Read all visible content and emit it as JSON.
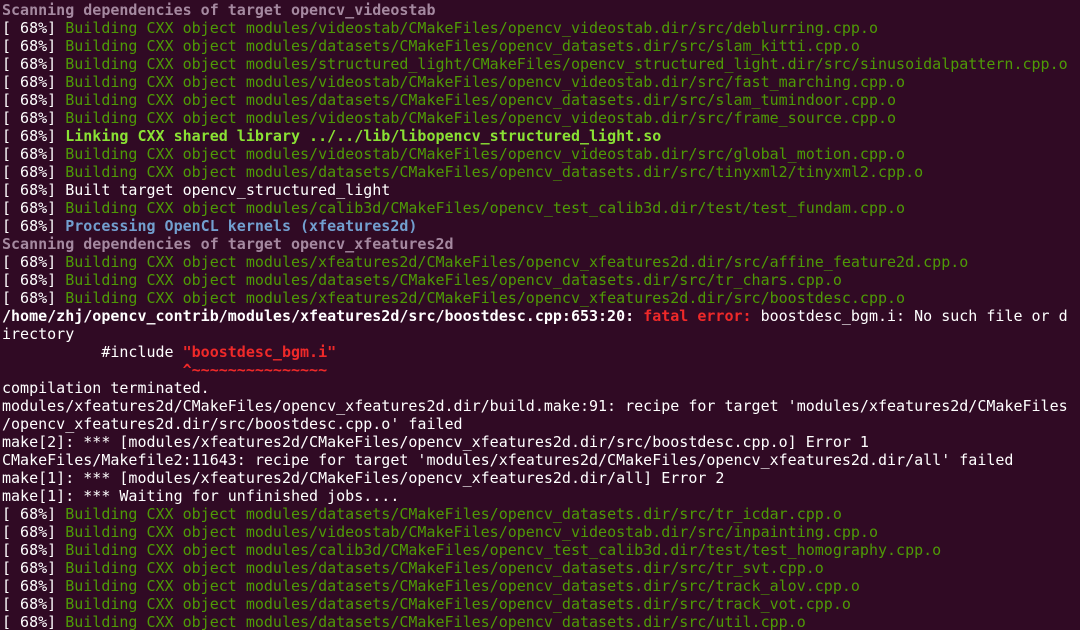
{
  "lines": [
    {
      "type": "scan",
      "text": "Scanning dependencies of target opencv_videostab"
    },
    {
      "type": "build",
      "prefix": "[ 68%] ",
      "text": "Building CXX object modules/videostab/CMakeFiles/opencv_videostab.dir/src/deblurring.cpp.o"
    },
    {
      "type": "build",
      "prefix": "[ 68%] ",
      "text": "Building CXX object modules/datasets/CMakeFiles/opencv_datasets.dir/src/slam_kitti.cpp.o"
    },
    {
      "type": "build",
      "prefix": "[ 68%] ",
      "text": "Building CXX object modules/structured_light/CMakeFiles/opencv_structured_light.dir/src/sinusoidalpattern.cpp.o"
    },
    {
      "type": "build",
      "prefix": "[ 68%] ",
      "text": "Building CXX object modules/videostab/CMakeFiles/opencv_videostab.dir/src/fast_marching.cpp.o"
    },
    {
      "type": "build",
      "prefix": "[ 68%] ",
      "text": "Building CXX object modules/datasets/CMakeFiles/opencv_datasets.dir/src/slam_tumindoor.cpp.o"
    },
    {
      "type": "build",
      "prefix": "[ 68%] ",
      "text": "Building CXX object modules/videostab/CMakeFiles/opencv_videostab.dir/src/frame_source.cpp.o"
    },
    {
      "type": "link",
      "prefix": "[ 68%] ",
      "text": "Linking CXX shared library ../../lib/libopencv_structured_light.so"
    },
    {
      "type": "build",
      "prefix": "[ 68%] ",
      "text": "Building CXX object modules/videostab/CMakeFiles/opencv_videostab.dir/src/global_motion.cpp.o"
    },
    {
      "type": "build",
      "prefix": "[ 68%] ",
      "text": "Building CXX object modules/datasets/CMakeFiles/opencv_datasets.dir/src/tinyxml2/tinyxml2.cpp.o"
    },
    {
      "type": "plain",
      "prefix": "[ 68%] ",
      "text": "Built target opencv_structured_light"
    },
    {
      "type": "build",
      "prefix": "[ 68%] ",
      "text": "Building CXX object modules/calib3d/CMakeFiles/opencv_test_calib3d.dir/test/test_fundam.cpp.o"
    },
    {
      "type": "process",
      "prefix": "[ 68%] ",
      "text": "Processing OpenCL kernels (xfeatures2d)"
    },
    {
      "type": "scan",
      "text": "Scanning dependencies of target opencv_xfeatures2d"
    },
    {
      "type": "build",
      "prefix": "[ 68%] ",
      "text": "Building CXX object modules/xfeatures2d/CMakeFiles/opencv_xfeatures2d.dir/src/affine_feature2d.cpp.o"
    },
    {
      "type": "build",
      "prefix": "[ 68%] ",
      "text": "Building CXX object modules/datasets/CMakeFiles/opencv_datasets.dir/src/tr_chars.cpp.o"
    },
    {
      "type": "build",
      "prefix": "[ 68%] ",
      "text": "Building CXX object modules/xfeatures2d/CMakeFiles/opencv_xfeatures2d.dir/src/boostdesc.cpp.o"
    },
    {
      "type": "error",
      "location": "/home/zhj/opencv_contrib/modules/xfeatures2d/src/boostdesc.cpp:653:20: ",
      "label": "fatal error:",
      "message": " boostdesc_bgm.i: No such file or d"
    },
    {
      "type": "plain",
      "text": "irectory"
    },
    {
      "type": "include",
      "indent": "           ",
      "directive": "#include ",
      "file": "\"boostdesc_bgm.i\""
    },
    {
      "type": "caret",
      "indent": "                    ",
      "text": "^~~~~~~~~~~~~~~~"
    },
    {
      "type": "plain",
      "text": "compilation terminated."
    },
    {
      "type": "plain",
      "text": "modules/xfeatures2d/CMakeFiles/opencv_xfeatures2d.dir/build.make:91: recipe for target 'modules/xfeatures2d/CMakeFiles"
    },
    {
      "type": "plain",
      "text": "/opencv_xfeatures2d.dir/src/boostdesc.cpp.o' failed"
    },
    {
      "type": "plain",
      "text": "make[2]: *** [modules/xfeatures2d/CMakeFiles/opencv_xfeatures2d.dir/src/boostdesc.cpp.o] Error 1"
    },
    {
      "type": "plain",
      "text": "CMakeFiles/Makefile2:11643: recipe for target 'modules/xfeatures2d/CMakeFiles/opencv_xfeatures2d.dir/all' failed"
    },
    {
      "type": "plain",
      "text": "make[1]: *** [modules/xfeatures2d/CMakeFiles/opencv_xfeatures2d.dir/all] Error 2"
    },
    {
      "type": "plain",
      "text": "make[1]: *** Waiting for unfinished jobs...."
    },
    {
      "type": "build",
      "prefix": "[ 68%] ",
      "text": "Building CXX object modules/datasets/CMakeFiles/opencv_datasets.dir/src/tr_icdar.cpp.o"
    },
    {
      "type": "build",
      "prefix": "[ 68%] ",
      "text": "Building CXX object modules/videostab/CMakeFiles/opencv_videostab.dir/src/inpainting.cpp.o"
    },
    {
      "type": "build",
      "prefix": "[ 68%] ",
      "text": "Building CXX object modules/calib3d/CMakeFiles/opencv_test_calib3d.dir/test/test_homography.cpp.o"
    },
    {
      "type": "build",
      "prefix": "[ 68%] ",
      "text": "Building CXX object modules/datasets/CMakeFiles/opencv_datasets.dir/src/tr_svt.cpp.o"
    },
    {
      "type": "build",
      "prefix": "[ 68%] ",
      "text": "Building CXX object modules/datasets/CMakeFiles/opencv_datasets.dir/src/track_alov.cpp.o"
    },
    {
      "type": "build",
      "prefix": "[ 68%] ",
      "text": "Building CXX object modules/datasets/CMakeFiles/opencv_datasets.dir/src/track_vot.cpp.o"
    },
    {
      "type": "build",
      "prefix": "[ 68%] ",
      "text": "Building CXX object modules/datasets/CMakeFiles/opencv_datasets.dir/src/util.cpp.o"
    }
  ],
  "colors": {
    "background": "#300a24",
    "default_text": "#ffffff",
    "build_green": "#4e9a06",
    "link_green": "#8ae234",
    "process_blue": "#729fcf",
    "scan_purple": "#a589a0",
    "error_red": "#ef2929"
  }
}
